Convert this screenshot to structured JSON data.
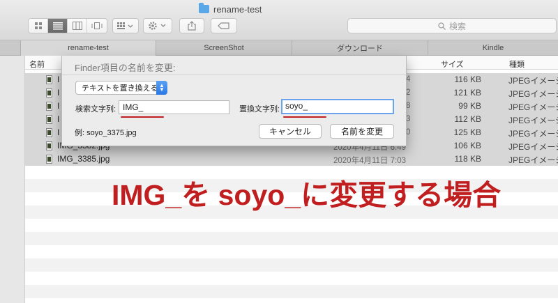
{
  "window": {
    "title": "rename-test"
  },
  "toolbar": {
    "view_modes": [
      "icon-view",
      "list-view",
      "column-view",
      "cover-flow-view"
    ],
    "search_placeholder": "検索"
  },
  "tabs": [
    "rename-test",
    "ScreenShot",
    "ダウンロード",
    "Kindle"
  ],
  "columns": {
    "name": "名前",
    "size": "サイズ",
    "kind": "種類"
  },
  "files": [
    {
      "name": "I",
      "date": "4",
      "size": "116 KB",
      "kind": "JPEGイメージ"
    },
    {
      "name": "I",
      "date": "2",
      "size": "121 KB",
      "kind": "JPEGイメージ"
    },
    {
      "name": "I",
      "date": "8",
      "size": "99 KB",
      "kind": "JPEGイメージ"
    },
    {
      "name": "I",
      "date": "3",
      "size": "112 KB",
      "kind": "JPEGイメージ"
    },
    {
      "name": "I",
      "date": "0",
      "size": "125 KB",
      "kind": "JPEGイメージ"
    },
    {
      "name": "IMG_3382.jpg",
      "date": "2020年4月11日 6:49",
      "size": "106 KB",
      "kind": "JPEGイメージ"
    },
    {
      "name": "IMG_3385.jpg",
      "date": "2020年4月11日 7:03",
      "size": "118 KB",
      "kind": "JPEGイメージ"
    }
  ],
  "dialog": {
    "title": "Finder項目の名前を変更:",
    "mode": "テキストを置き換える",
    "find_label": "検索文字列:",
    "find_value": "IMG_",
    "replace_label": "置換文字列:",
    "replace_value": "soyo_",
    "example": "例: soyo_3375.jpg",
    "cancel": "キャンセル",
    "rename": "名前を変更"
  },
  "overlay": {
    "text": "IMG_を soyo_に変更する場合"
  },
  "colors": {
    "accent_red": "#c11f1f",
    "focus_blue": "#6ba3ef"
  }
}
